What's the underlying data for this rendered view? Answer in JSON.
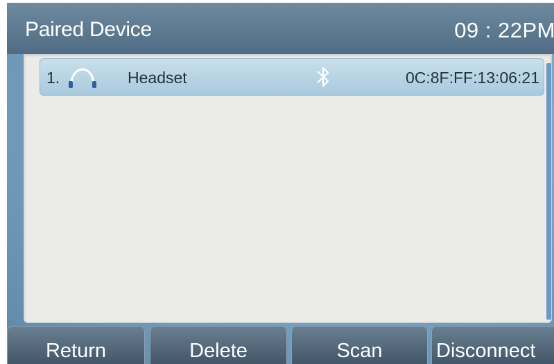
{
  "header": {
    "title": "Paired Device",
    "time": "09 : 22PM"
  },
  "devices": [
    {
      "index": "1.",
      "icon": "headset-icon",
      "name": "Headset",
      "status_icon": "bluetooth-icon",
      "address": "0C:8F:FF:13:06:21"
    }
  ],
  "softkeys": {
    "return": "Return",
    "delete": "Delete",
    "scan": "Scan",
    "disconnect": "Disconnect"
  },
  "colors": {
    "selected_row": "#b8d5e6",
    "list_background": "#ebebe8",
    "accent_icon": "#2f5f9e"
  }
}
